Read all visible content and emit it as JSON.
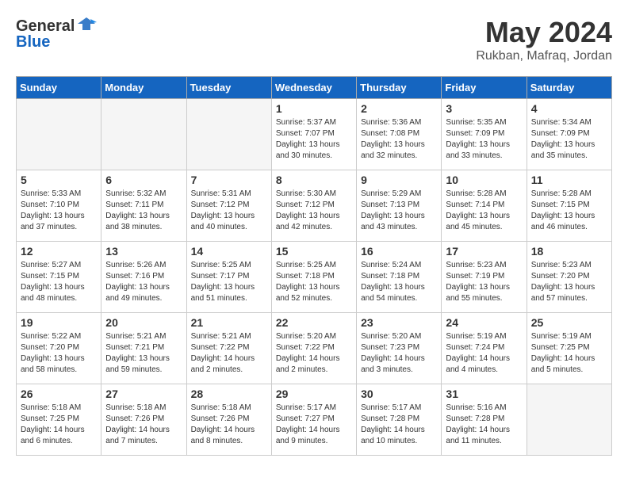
{
  "header": {
    "logo_general": "General",
    "logo_blue": "Blue",
    "month": "May 2024",
    "location": "Rukban, Mafraq, Jordan"
  },
  "weekdays": [
    "Sunday",
    "Monday",
    "Tuesday",
    "Wednesday",
    "Thursday",
    "Friday",
    "Saturday"
  ],
  "weeks": [
    [
      {
        "day": "",
        "sunrise": "",
        "sunset": "",
        "daylight": "",
        "empty": true
      },
      {
        "day": "",
        "sunrise": "",
        "sunset": "",
        "daylight": "",
        "empty": true
      },
      {
        "day": "",
        "sunrise": "",
        "sunset": "",
        "daylight": "",
        "empty": true
      },
      {
        "day": "1",
        "sunrise": "Sunrise: 5:37 AM",
        "sunset": "Sunset: 7:07 PM",
        "daylight": "Daylight: 13 hours and 30 minutes.",
        "empty": false
      },
      {
        "day": "2",
        "sunrise": "Sunrise: 5:36 AM",
        "sunset": "Sunset: 7:08 PM",
        "daylight": "Daylight: 13 hours and 32 minutes.",
        "empty": false
      },
      {
        "day": "3",
        "sunrise": "Sunrise: 5:35 AM",
        "sunset": "Sunset: 7:09 PM",
        "daylight": "Daylight: 13 hours and 33 minutes.",
        "empty": false
      },
      {
        "day": "4",
        "sunrise": "Sunrise: 5:34 AM",
        "sunset": "Sunset: 7:09 PM",
        "daylight": "Daylight: 13 hours and 35 minutes.",
        "empty": false
      }
    ],
    [
      {
        "day": "5",
        "sunrise": "Sunrise: 5:33 AM",
        "sunset": "Sunset: 7:10 PM",
        "daylight": "Daylight: 13 hours and 37 minutes.",
        "empty": false
      },
      {
        "day": "6",
        "sunrise": "Sunrise: 5:32 AM",
        "sunset": "Sunset: 7:11 PM",
        "daylight": "Daylight: 13 hours and 38 minutes.",
        "empty": false
      },
      {
        "day": "7",
        "sunrise": "Sunrise: 5:31 AM",
        "sunset": "Sunset: 7:12 PM",
        "daylight": "Daylight: 13 hours and 40 minutes.",
        "empty": false
      },
      {
        "day": "8",
        "sunrise": "Sunrise: 5:30 AM",
        "sunset": "Sunset: 7:12 PM",
        "daylight": "Daylight: 13 hours and 42 minutes.",
        "empty": false
      },
      {
        "day": "9",
        "sunrise": "Sunrise: 5:29 AM",
        "sunset": "Sunset: 7:13 PM",
        "daylight": "Daylight: 13 hours and 43 minutes.",
        "empty": false
      },
      {
        "day": "10",
        "sunrise": "Sunrise: 5:28 AM",
        "sunset": "Sunset: 7:14 PM",
        "daylight": "Daylight: 13 hours and 45 minutes.",
        "empty": false
      },
      {
        "day": "11",
        "sunrise": "Sunrise: 5:28 AM",
        "sunset": "Sunset: 7:15 PM",
        "daylight": "Daylight: 13 hours and 46 minutes.",
        "empty": false
      }
    ],
    [
      {
        "day": "12",
        "sunrise": "Sunrise: 5:27 AM",
        "sunset": "Sunset: 7:15 PM",
        "daylight": "Daylight: 13 hours and 48 minutes.",
        "empty": false
      },
      {
        "day": "13",
        "sunrise": "Sunrise: 5:26 AM",
        "sunset": "Sunset: 7:16 PM",
        "daylight": "Daylight: 13 hours and 49 minutes.",
        "empty": false
      },
      {
        "day": "14",
        "sunrise": "Sunrise: 5:25 AM",
        "sunset": "Sunset: 7:17 PM",
        "daylight": "Daylight: 13 hours and 51 minutes.",
        "empty": false
      },
      {
        "day": "15",
        "sunrise": "Sunrise: 5:25 AM",
        "sunset": "Sunset: 7:18 PM",
        "daylight": "Daylight: 13 hours and 52 minutes.",
        "empty": false
      },
      {
        "day": "16",
        "sunrise": "Sunrise: 5:24 AM",
        "sunset": "Sunset: 7:18 PM",
        "daylight": "Daylight: 13 hours and 54 minutes.",
        "empty": false
      },
      {
        "day": "17",
        "sunrise": "Sunrise: 5:23 AM",
        "sunset": "Sunset: 7:19 PM",
        "daylight": "Daylight: 13 hours and 55 minutes.",
        "empty": false
      },
      {
        "day": "18",
        "sunrise": "Sunrise: 5:23 AM",
        "sunset": "Sunset: 7:20 PM",
        "daylight": "Daylight: 13 hours and 57 minutes.",
        "empty": false
      }
    ],
    [
      {
        "day": "19",
        "sunrise": "Sunrise: 5:22 AM",
        "sunset": "Sunset: 7:20 PM",
        "daylight": "Daylight: 13 hours and 58 minutes.",
        "empty": false
      },
      {
        "day": "20",
        "sunrise": "Sunrise: 5:21 AM",
        "sunset": "Sunset: 7:21 PM",
        "daylight": "Daylight: 13 hours and 59 minutes.",
        "empty": false
      },
      {
        "day": "21",
        "sunrise": "Sunrise: 5:21 AM",
        "sunset": "Sunset: 7:22 PM",
        "daylight": "Daylight: 14 hours and 2 minutes.",
        "empty": false
      },
      {
        "day": "22",
        "sunrise": "Sunrise: 5:20 AM",
        "sunset": "Sunset: 7:22 PM",
        "daylight": "Daylight: 14 hours and 2 minutes.",
        "empty": false
      },
      {
        "day": "23",
        "sunrise": "Sunrise: 5:20 AM",
        "sunset": "Sunset: 7:23 PM",
        "daylight": "Daylight: 14 hours and 3 minutes.",
        "empty": false
      },
      {
        "day": "24",
        "sunrise": "Sunrise: 5:19 AM",
        "sunset": "Sunset: 7:24 PM",
        "daylight": "Daylight: 14 hours and 4 minutes.",
        "empty": false
      },
      {
        "day": "25",
        "sunrise": "Sunrise: 5:19 AM",
        "sunset": "Sunset: 7:25 PM",
        "daylight": "Daylight: 14 hours and 5 minutes.",
        "empty": false
      }
    ],
    [
      {
        "day": "26",
        "sunrise": "Sunrise: 5:18 AM",
        "sunset": "Sunset: 7:25 PM",
        "daylight": "Daylight: 14 hours and 6 minutes.",
        "empty": false
      },
      {
        "day": "27",
        "sunrise": "Sunrise: 5:18 AM",
        "sunset": "Sunset: 7:26 PM",
        "daylight": "Daylight: 14 hours and 7 minutes.",
        "empty": false
      },
      {
        "day": "28",
        "sunrise": "Sunrise: 5:18 AM",
        "sunset": "Sunset: 7:26 PM",
        "daylight": "Daylight: 14 hours and 8 minutes.",
        "empty": false
      },
      {
        "day": "29",
        "sunrise": "Sunrise: 5:17 AM",
        "sunset": "Sunset: 7:27 PM",
        "daylight": "Daylight: 14 hours and 9 minutes.",
        "empty": false
      },
      {
        "day": "30",
        "sunrise": "Sunrise: 5:17 AM",
        "sunset": "Sunset: 7:28 PM",
        "daylight": "Daylight: 14 hours and 10 minutes.",
        "empty": false
      },
      {
        "day": "31",
        "sunrise": "Sunrise: 5:16 AM",
        "sunset": "Sunset: 7:28 PM",
        "daylight": "Daylight: 14 hours and 11 minutes.",
        "empty": false
      },
      {
        "day": "",
        "sunrise": "",
        "sunset": "",
        "daylight": "",
        "empty": true
      }
    ]
  ]
}
